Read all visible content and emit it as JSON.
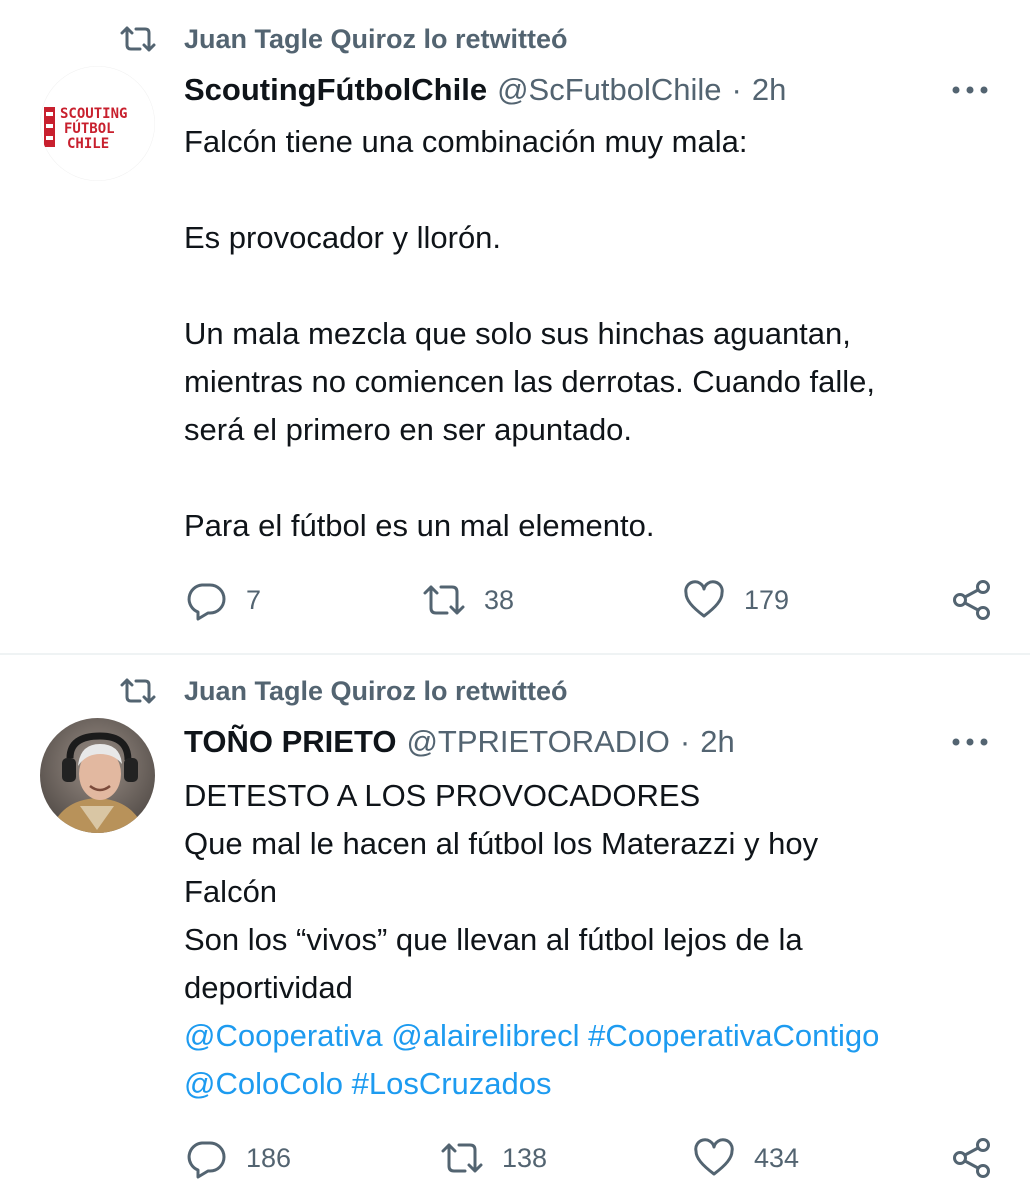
{
  "tweets": [
    {
      "retweeted_by": "Juan Tagle Quiroz lo retwitteó",
      "author_name": "ScoutingFútbolChile",
      "author_handle": "@ScFutbolChile",
      "separator": "·",
      "time": "2h",
      "avatar_text": [
        "SCOUTING",
        "FÚTBOL",
        "CHILE"
      ],
      "avatar_color": "#c8202e",
      "lines": [
        "Falcón tiene una combinación muy mala:",
        "",
        "Es provocador y llorón.",
        "",
        "Un mala mezcla que solo sus hinchas aguantan,",
        "mientras no comiencen las derrotas. Cuando falle,",
        "será el primero en ser apuntado.",
        "",
        "Para el fútbol es un mal elemento."
      ],
      "replies": "7",
      "retweets": "38",
      "likes": "179"
    },
    {
      "retweeted_by": "Juan Tagle Quiroz lo retwitteó",
      "author_name": "TOÑO PRIETO",
      "author_handle": "@TPRIETORADIO",
      "separator": "·",
      "time": "2h",
      "lines": [
        "DETESTO A LOS PROVOCADORES",
        "Que mal le hacen al fútbol los Materazzi y hoy",
        "Falcón",
        "Son los “vivos” que llevan al fútbol lejos de la",
        "deportividad"
      ],
      "link_lines": [
        [
          "@Cooperativa",
          "@alairelibrecl",
          "#CooperativaContigo"
        ],
        [
          "@ColoColo",
          "#LosCruzados"
        ]
      ],
      "replies": "186",
      "retweets": "138",
      "likes": "434"
    }
  ],
  "colors": {
    "text": "#0f1419",
    "secondary": "#536471",
    "link": "#1d9bf0",
    "divider": "#eff3f4"
  },
  "icons": {
    "retweet_context": "retweet-icon",
    "more": "more-icon",
    "reply": "reply-icon",
    "retweet": "retweet-icon",
    "like": "heart-icon",
    "share": "share-icon"
  }
}
